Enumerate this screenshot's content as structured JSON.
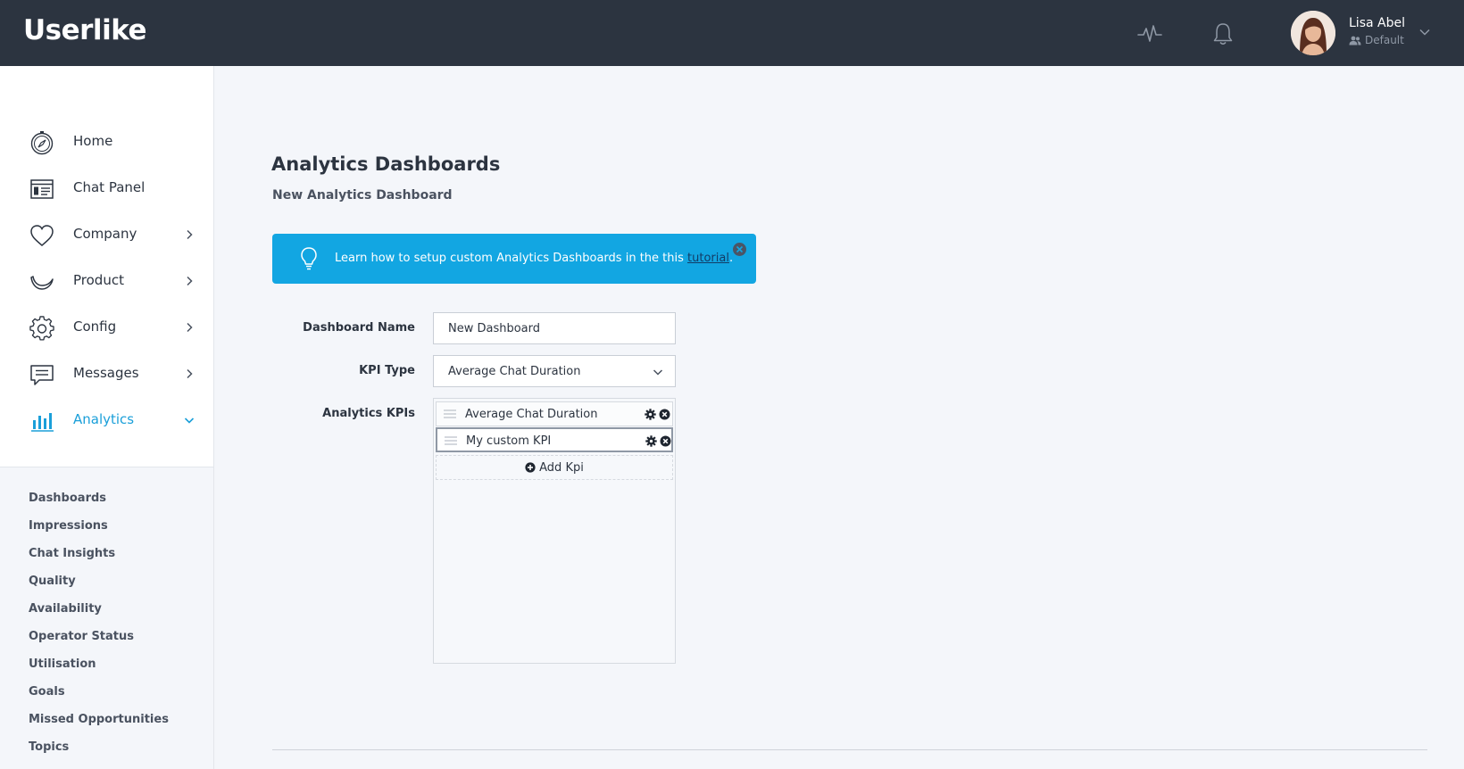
{
  "app": {
    "logo_text": "Userlike",
    "brand_color": "#1a9fd9",
    "header_bg": "#2c3440"
  },
  "header": {
    "icons": [
      "activity-pulse-icon",
      "bell-icon"
    ],
    "user": {
      "name": "Lisa Abel",
      "role": "Default"
    }
  },
  "sidebar": {
    "items": [
      {
        "label": "Home",
        "icon": "compass-icon",
        "expandable": false
      },
      {
        "label": "Chat Panel",
        "icon": "chat-panel-icon",
        "expandable": false
      },
      {
        "label": "Company",
        "icon": "heart-icon",
        "expandable": true
      },
      {
        "label": "Product",
        "icon": "product-swoosh-icon",
        "expandable": true
      },
      {
        "label": "Config",
        "icon": "gear-icon",
        "expandable": true
      },
      {
        "label": "Messages",
        "icon": "message-icon",
        "expandable": true
      },
      {
        "label": "Analytics",
        "icon": "bar-chart-icon",
        "expandable": true,
        "active": true
      }
    ],
    "sub_items": [
      "Dashboards",
      "Impressions",
      "Chat Insights",
      "Quality",
      "Availability",
      "Operator Status",
      "Utilisation",
      "Goals",
      "Missed Opportunities",
      "Topics"
    ]
  },
  "main": {
    "title": "Analytics Dashboards",
    "subtitle": "New Analytics Dashboard",
    "banner": {
      "text": "Learn how to setup custom Analytics Dashboards in the this ",
      "link": "tutorial",
      "suffix": ".",
      "bg_color": "#12a6e2"
    },
    "form": {
      "dashboard_name_label": "Dashboard Name",
      "dashboard_name_value": "New Dashboard",
      "kpi_type_label": "KPI Type",
      "kpi_type_value": "Average Chat Duration",
      "analytics_kpis_label": "Analytics KPIs",
      "kpis": [
        {
          "label": "Average Chat Duration",
          "selected": false
        },
        {
          "label": "My custom KPI",
          "selected": true
        }
      ],
      "add_kpi_label": "Add Kpi"
    }
  }
}
